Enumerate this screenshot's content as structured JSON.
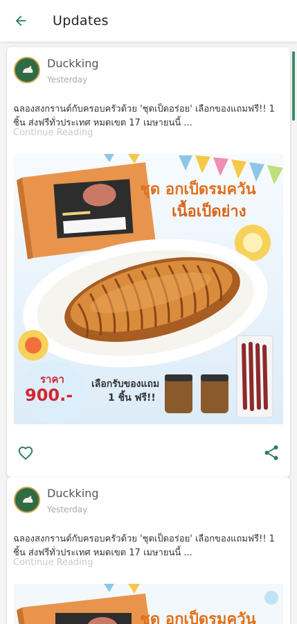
{
  "appbar": {
    "title": "Updates"
  },
  "posts": [
    {
      "author": "Duckking",
      "time": "Yesterday",
      "text": "ฉลองสงกรานต์กับครอบครัวด้วย 'ชุดเป็ดอร่อย' เลือกของแถมฟรี!! 1 ชิ้น ส่งฟรีทั่วประเทศ หมดเขต 17 เมษายนนี้ ...",
      "more": "Continue Reading",
      "image": {
        "headline1": "ชุด อกเป็ดรมควัน",
        "headline2": "เนื้อเป็ดย่าง",
        "price_label": "ราคา",
        "price": "900.-",
        "gift_line1": "เลือกรับของแถม",
        "gift_line2": "1 ชิ้น ฟรี!!"
      }
    },
    {
      "author": "Duckking",
      "time": "Yesterday",
      "text": "ฉลองสงกรานต์กับครอบครัวด้วย 'ชุดเป็ดอร่อย' เลือกของแถมฟรี!! 1 ชิ้น ส่งฟรีทั่วประเทศ หมดเขต 17 เมษายนนี้ ...",
      "more": "Continue Reading",
      "image": {
        "headline1": "ชุด อกเป็ดรมควัน"
      }
    }
  ],
  "icons": {
    "back": "arrow-left-icon",
    "like": "heart-outline-icon",
    "share": "share-icon"
  },
  "colors": {
    "accent": "#2e7d57",
    "price_red": "#d3262e",
    "headline_orange": "#e0701b"
  }
}
